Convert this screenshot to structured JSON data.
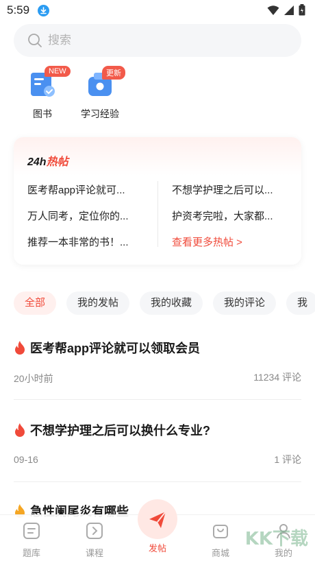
{
  "status_bar": {
    "time": "5:59"
  },
  "search": {
    "placeholder": "搜索"
  },
  "shortcuts": [
    {
      "label": "图书",
      "badge": "NEW",
      "icon": "book-icon"
    },
    {
      "label": "学习经验",
      "badge": "更新",
      "icon": "experience-icon"
    }
  ],
  "hot_posts": {
    "title_prefix": "24h",
    "title_suffix": "热帖",
    "left": [
      "医考帮app评论就可...",
      "万人同考，定位你的...",
      "推荐一本非常的书！..."
    ],
    "right": [
      "不想学护理之后可以...",
      "护资考完啦，大家都..."
    ],
    "more_label": "查看更多热帖 >"
  },
  "tabs": [
    "全部",
    "我的发帖",
    "我的收藏",
    "我的评论",
    "我"
  ],
  "posts": [
    {
      "title": "医考帮app评论就可以领取会员",
      "time": "20小时前",
      "count": "11234 评论"
    },
    {
      "title": "不想学护理之后可以换什么专业?",
      "time": "09-16",
      "count": "1 评论"
    },
    {
      "title": "急性阑尾炎有哪些",
      "time": "",
      "count": ""
    }
  ],
  "bottom_nav": [
    {
      "label": "题库",
      "icon": "question-bank-icon"
    },
    {
      "label": "课程",
      "icon": "course-icon"
    },
    {
      "label": "发帖",
      "icon": "send-icon"
    },
    {
      "label": "商城",
      "icon": "shop-icon"
    },
    {
      "label": "我的",
      "icon": "profile-icon"
    }
  ],
  "watermark": "KK下载",
  "colors": {
    "accent": "#f04a3a",
    "badge": "#f25a4a",
    "muted": "#999999"
  }
}
